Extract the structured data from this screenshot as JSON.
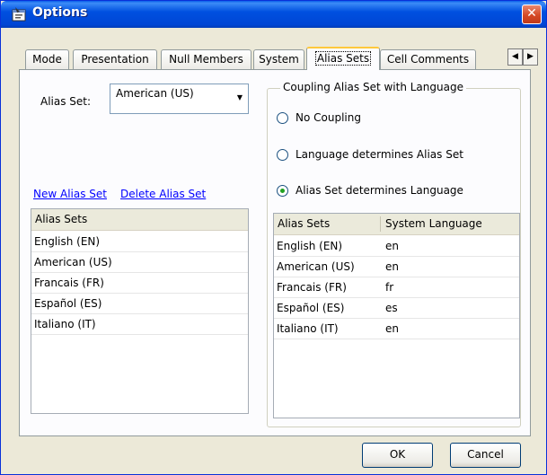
{
  "window": {
    "title": "Options"
  },
  "tabs": [
    {
      "label": "Mode"
    },
    {
      "label": "Presentation"
    },
    {
      "label": "Null Members"
    },
    {
      "label": "System"
    },
    {
      "label": "Alias Sets"
    },
    {
      "label": "Cell Comments"
    }
  ],
  "active_tab": "Alias Sets",
  "tab_scroll": {
    "left": "◀",
    "right": "▶"
  },
  "alias_set": {
    "label": "Alias Set:",
    "selected": "American (US)"
  },
  "links": {
    "new": "New Alias Set",
    "delete": "Delete Alias Set"
  },
  "left_list": {
    "header": "Alias Sets",
    "rows": [
      "English (EN)",
      "American (US)",
      "Francais (FR)",
      "Español (ES)",
      "Italiano (IT)"
    ]
  },
  "coupling": {
    "title": "Coupling Alias Set with Language",
    "options": [
      {
        "label": "No Coupling",
        "selected": false
      },
      {
        "label": "Language determines Alias Set",
        "selected": false
      },
      {
        "label": "Alias Set determines Language",
        "selected": true
      }
    ]
  },
  "right_table": {
    "headers": [
      "Alias Sets",
      "System Language"
    ],
    "rows": [
      [
        "English (EN)",
        "en"
      ],
      [
        "American (US)",
        "en"
      ],
      [
        "Francais (FR)",
        "fr"
      ],
      [
        "Español (ES)",
        "es"
      ],
      [
        "Italiano (IT)",
        "en"
      ]
    ]
  },
  "buttons": {
    "ok": "OK",
    "cancel": "Cancel"
  },
  "icons": {
    "title": "options-window-icon",
    "close": "close-icon",
    "combo": "chevron-down-icon"
  },
  "colors": {
    "titlebar": "#0050E0",
    "link": "#0000FF",
    "active_tab_accent": "#FFC83C"
  }
}
